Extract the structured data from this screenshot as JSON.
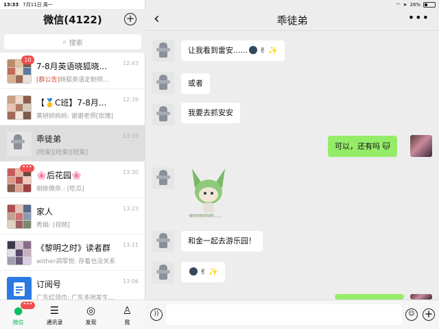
{
  "status_bar": {
    "time": "13:33",
    "date": "7月11日 周一",
    "battery": "28%",
    "battery_level": 0.28
  },
  "sidebar": {
    "title": "微信(4122)",
    "search_placeholder": "搜索",
    "chats": [
      {
        "name": "7-8月英语晓狐晓...",
        "tag": "[群公告]",
        "preview": "晓狐英语定制师...",
        "time": "12:43",
        "badge": "10"
      },
      {
        "name": "【🥇C班】7-8月...",
        "tag": "",
        "preview": "黄妍妍妈妈: 谢谢老师[玫瑰]",
        "time": "12:39",
        "badge": ""
      },
      {
        "name": "乖徒弟",
        "tag": "",
        "preview": "[旺柴][旺柴][旺柴]",
        "time": "13:33",
        "badge": ""
      },
      {
        "name": "🌸后花园🌸",
        "tag": "",
        "preview": "相依微命.: [吃瓜]",
        "time": "13:30",
        "badge": "•••"
      },
      {
        "name": "家人",
        "tag": "",
        "preview": "秀娟: [视频]",
        "time": "13:23",
        "badge": ""
      },
      {
        "name": "《黎明之时》读者群",
        "tag": "",
        "preview": "wither凋零悦: 存着也没关系",
        "time": "13:11",
        "badge": ""
      },
      {
        "name": "订阅号",
        "tag": "",
        "preview": "广东红领巾: 广东多地发生...",
        "time": "13:06",
        "badge": ""
      }
    ],
    "tabs": [
      {
        "label": "微信",
        "icon": "chat-icon",
        "badge": "•••"
      },
      {
        "label": "通讯录",
        "icon": "contacts-icon"
      },
      {
        "label": "发现",
        "icon": "compass-icon"
      },
      {
        "label": "我",
        "icon": "person-icon"
      }
    ]
  },
  "conversation": {
    "title": "乖徒弟",
    "messages": [
      {
        "from": "other",
        "text": "让我看到雷安......",
        "emoji": "✌ ✨"
      },
      {
        "from": "other",
        "text": "或者"
      },
      {
        "from": "other",
        "text": "我要去抓安安"
      },
      {
        "from": "me",
        "text": "可以，还有吗"
      },
      {
        "from": "other",
        "sticker_caption": "emmmm...."
      },
      {
        "from": "other",
        "text": "和金一起去游乐园！"
      },
      {
        "from": "other",
        "text": "",
        "emoji": "✌ ✨"
      }
    ]
  },
  "colors": {
    "accent": "#07c160",
    "bubble_me": "#95ec69",
    "badge": "#f04f4f",
    "tag": "#d14b3a"
  }
}
